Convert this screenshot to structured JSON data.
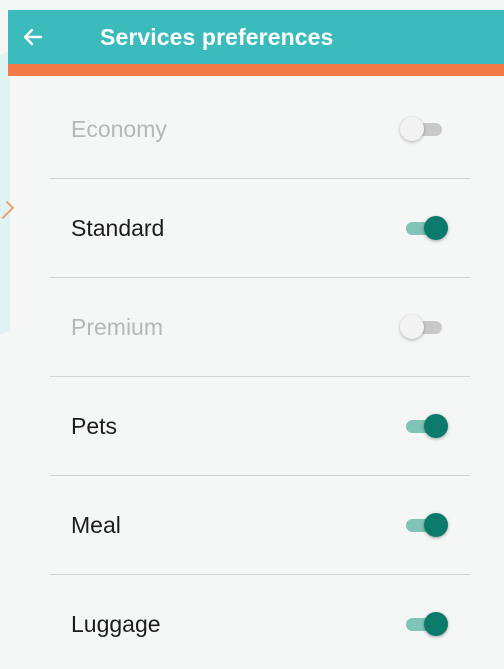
{
  "app_bar": {
    "title": "Services preferences",
    "back_icon": "arrow-left-icon",
    "background_color": "#3bbbbb",
    "accent_color": "#f27b47"
  },
  "services": [
    {
      "label": "Economy",
      "enabled": false,
      "checked": false
    },
    {
      "label": "Standard",
      "enabled": true,
      "checked": true
    },
    {
      "label": "Premium",
      "enabled": false,
      "checked": false
    },
    {
      "label": "Pets",
      "enabled": true,
      "checked": true
    },
    {
      "label": "Meal",
      "enabled": true,
      "checked": true
    },
    {
      "label": "Luggage",
      "enabled": true,
      "checked": true
    }
  ],
  "switch_colors": {
    "on_thumb": "#0c7a6b",
    "on_track": "#7fc4b7",
    "off_thumb": "#f1f1f1",
    "off_track": "#b9b9b9"
  }
}
